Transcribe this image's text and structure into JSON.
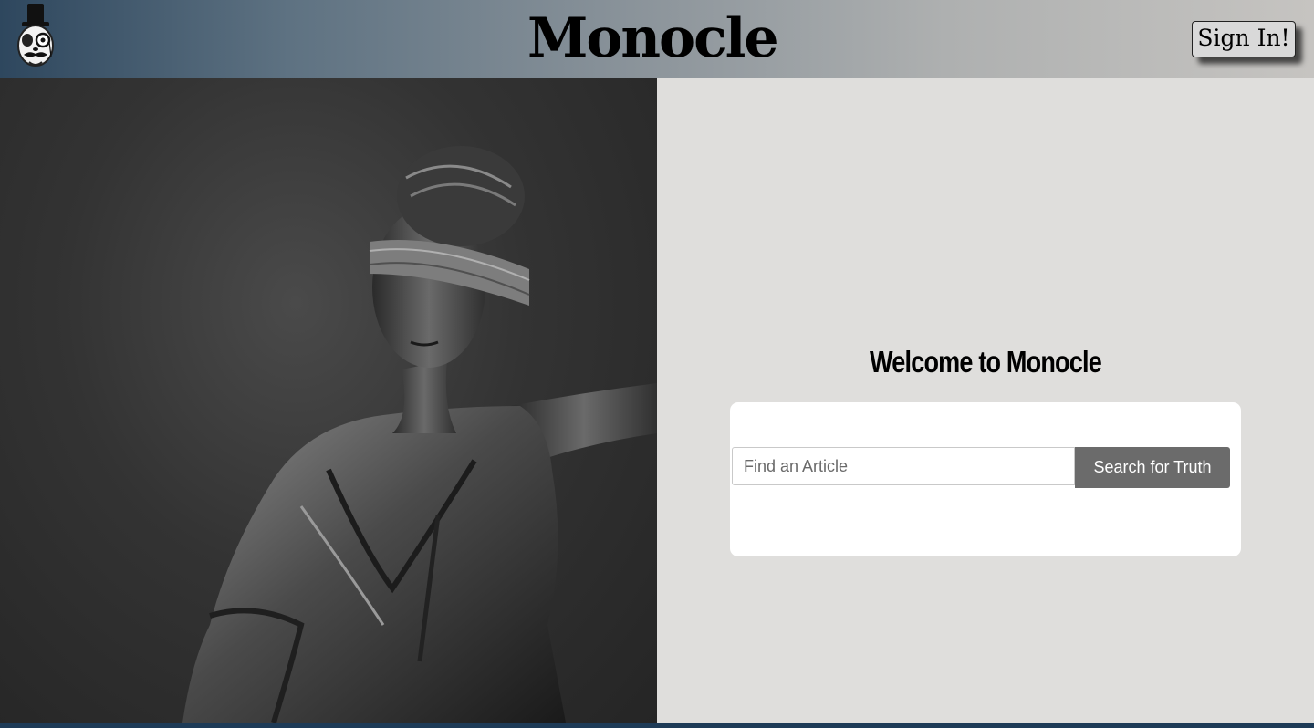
{
  "header": {
    "title": "Monocle",
    "sign_in_label": "Sign In!",
    "logo_icon": "monocle-gentleman-logo-icon"
  },
  "hero": {
    "image": "blindfolded-lady-justice-statue"
  },
  "main": {
    "welcome_heading": "Welcome to Monocle",
    "search": {
      "placeholder": "Find an Article",
      "value": "",
      "button_label": "Search for Truth"
    }
  },
  "colors": {
    "panel_background": "#dfdedc",
    "card_background": "#ffffff",
    "button_background": "#6b6b6b",
    "header_gradient_start": "#2e475e",
    "header_gradient_end": "#c6c4c1"
  }
}
